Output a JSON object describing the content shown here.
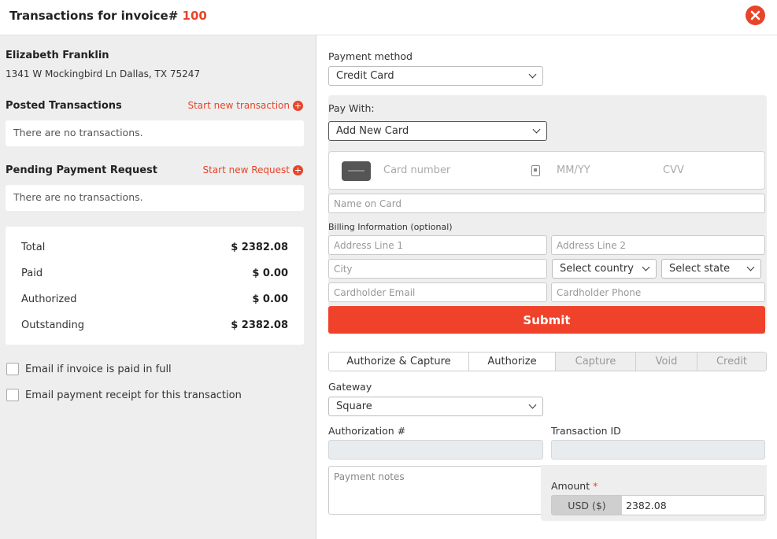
{
  "header": {
    "title_prefix": "Transactions for invoice#",
    "invoice_number": "100",
    "accent_color": "#e8442a"
  },
  "customer": {
    "name": "Elizabeth Franklin",
    "address": "1341 W Mockingbird Ln Dallas, TX 75247"
  },
  "posted": {
    "title": "Posted Transactions",
    "link": "Start new transaction",
    "empty": "There are no transactions."
  },
  "pending": {
    "title": "Pending Payment Request",
    "link": "Start new Request",
    "empty": "There are no transactions."
  },
  "totals": [
    {
      "label": "Total",
      "value": "$ 2382.08"
    },
    {
      "label": "Paid",
      "value": "$ 0.00"
    },
    {
      "label": "Authorized",
      "value": "$ 0.00"
    },
    {
      "label": "Outstanding",
      "value": "$ 2382.08"
    }
  ],
  "options": {
    "email_paid_full": "Email if invoice is paid in full",
    "email_receipt": "Email payment receipt for this transaction"
  },
  "payment": {
    "method_label": "Payment method",
    "method_value": "Credit Card",
    "pay_with_label": "Pay With:",
    "pay_with_value": "Add New Card",
    "card_number_ph": "Card number",
    "expiry_ph": "MM/YY",
    "cvv_ph": "CVV",
    "name_on_card_ph": "Name on Card",
    "billing_label": "Billing Information (optional)",
    "address1_ph": "Address Line 1",
    "address2_ph": "Address Line 2",
    "city_ph": "City",
    "country_value": "Select country",
    "state_value": "Select state",
    "email_ph": "Cardholder Email",
    "phone_ph": "Cardholder Phone",
    "submit": "Submit"
  },
  "tabs": [
    {
      "label": "Authorize & Capture",
      "state": "active"
    },
    {
      "label": "Authorize",
      "state": "active"
    },
    {
      "label": "Capture",
      "state": "disabled"
    },
    {
      "label": "Void",
      "state": "disabled"
    },
    {
      "label": "Credit",
      "state": "disabled"
    }
  ],
  "gateway": {
    "label": "Gateway",
    "value": "Square"
  },
  "auth": {
    "label": "Authorization #",
    "txn_label": "Transaction ID"
  },
  "notes_ph": "Payment notes",
  "amount": {
    "label": "Amount",
    "required_mark": "*",
    "currency": "USD ($)",
    "value": "2382.08"
  }
}
